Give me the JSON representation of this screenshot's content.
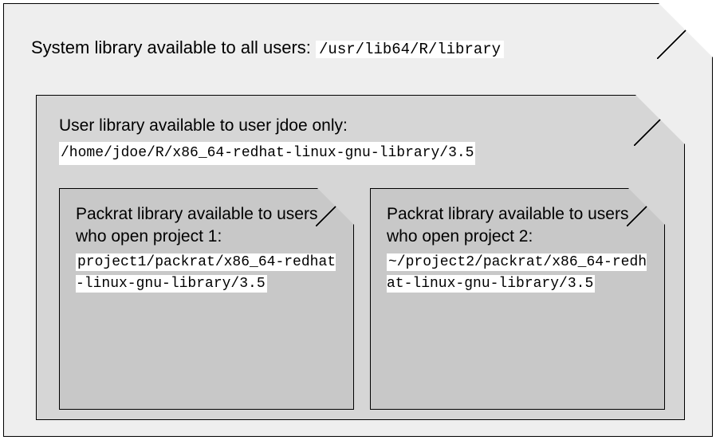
{
  "system": {
    "label": "System library available to all users: ",
    "path": "/usr/lib64/R/library"
  },
  "user": {
    "label": "User library available to user jdoe only:",
    "path": "/home/jdoe/R/x86_64-redhat-linux-gnu-library/3.5"
  },
  "project1": {
    "label": "Packrat library available to users who open project 1:",
    "path": "project1/packrat/x86_64-redhat-linux-gnu-library/3.5"
  },
  "project2": {
    "label": "Packrat library available to users who open project 2:",
    "path": "~/project2/packrat/x86_64-redhat-linux-gnu-library/3.5"
  }
}
